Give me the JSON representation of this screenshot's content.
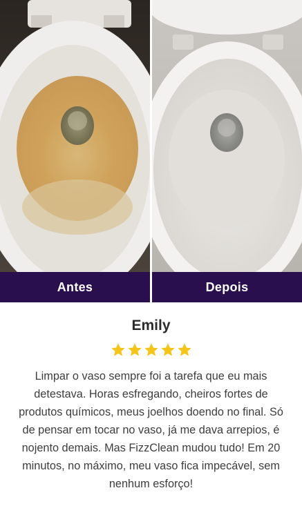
{
  "comparison": {
    "before_label": "Antes",
    "after_label": "Depois",
    "label_bar_color": "#2a0f4f"
  },
  "review": {
    "name": "Emily",
    "rating": 5,
    "star_color": "#f5c518",
    "text": "Limpar o vaso sempre foi a tarefa que eu mais detestava. Horas esfregando, cheiros fortes de produtos químicos, meus joelhos doendo no final. Só de pensar em tocar no vaso, já me dava arrepios, é nojento demais. Mas FizzClean mudou tudo! Em 20 minutos, no máximo, meu vaso fica impecável, sem nenhum esforço!"
  }
}
